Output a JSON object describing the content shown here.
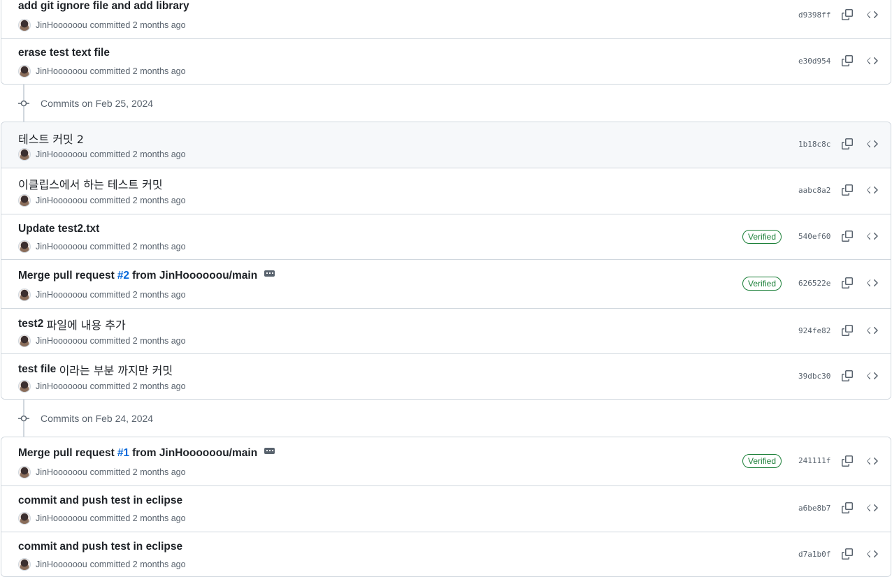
{
  "colors": {
    "accent": "#0969da",
    "verified": "#1a7f37",
    "muted": "#59636e",
    "border": "#d0d7de",
    "hover_row": "#f6f8fa"
  },
  "icons": {
    "copy": "copy-icon",
    "browse": "code-icon",
    "timeline": "git-commit-icon"
  },
  "groups": [
    {
      "header": "",
      "commits": [
        {
          "title": "add git ignore file and add library",
          "author": "JinHoooooou",
          "time": "committed 2 months ago",
          "sha": "d9398ff",
          "verified": ""
        },
        {
          "title": "erase test text file",
          "author": "JinHoooooou",
          "time": "committed 2 months ago",
          "sha": "e30d954",
          "verified": ""
        }
      ]
    },
    {
      "header": "Commits on Feb 25, 2024",
      "commits": [
        {
          "title": "테스트 커밋 2",
          "author": "JinHoooooou",
          "time": "committed 2 months ago",
          "sha": "1b18c8c",
          "verified": ""
        },
        {
          "title": "이클립스에서 하는 테스트 커밋",
          "author": "JinHoooooou",
          "time": "committed 2 months ago",
          "sha": "aabc8a2",
          "verified": ""
        },
        {
          "title": "Update test2.txt",
          "author": "JinHoooooou",
          "time": "committed 2 months ago",
          "sha": "540ef60",
          "verified": "Verified"
        },
        {
          "title_prefix": "Merge pull request",
          "pr": "#2",
          "title_suffix": "from JinHoooooou/main",
          "author": "JinHoooooou",
          "time": "committed 2 months ago",
          "sha": "626522e",
          "verified": "Verified"
        },
        {
          "title_bold": "test2",
          "title_rest": "파일에 내용 추가",
          "author": "JinHoooooou",
          "time": "committed 2 months ago",
          "sha": "924fe82",
          "verified": ""
        },
        {
          "title_bold": "test file",
          "title_rest": "이라는 부분 까지만 커밋",
          "author": "JinHoooooou",
          "time": "committed 2 months ago",
          "sha": "39dbc30",
          "verified": ""
        }
      ]
    },
    {
      "header": "Commits on Feb 24, 2024",
      "commits": [
        {
          "title_prefix": "Merge pull request",
          "pr": "#1",
          "title_suffix": "from JinHoooooou/main",
          "author": "JinHoooooou",
          "time": "committed 2 months ago",
          "sha": "241111f",
          "verified": "Verified"
        },
        {
          "title": "commit and push test in eclipse",
          "author": "JinHoooooou",
          "time": "committed 2 months ago",
          "sha": "a6be8b7",
          "verified": ""
        },
        {
          "title": "commit and push test in eclipse",
          "author": "JinHoooooou",
          "time": "committed 2 months ago",
          "sha": "d7a1b0f",
          "verified": ""
        }
      ]
    }
  ]
}
